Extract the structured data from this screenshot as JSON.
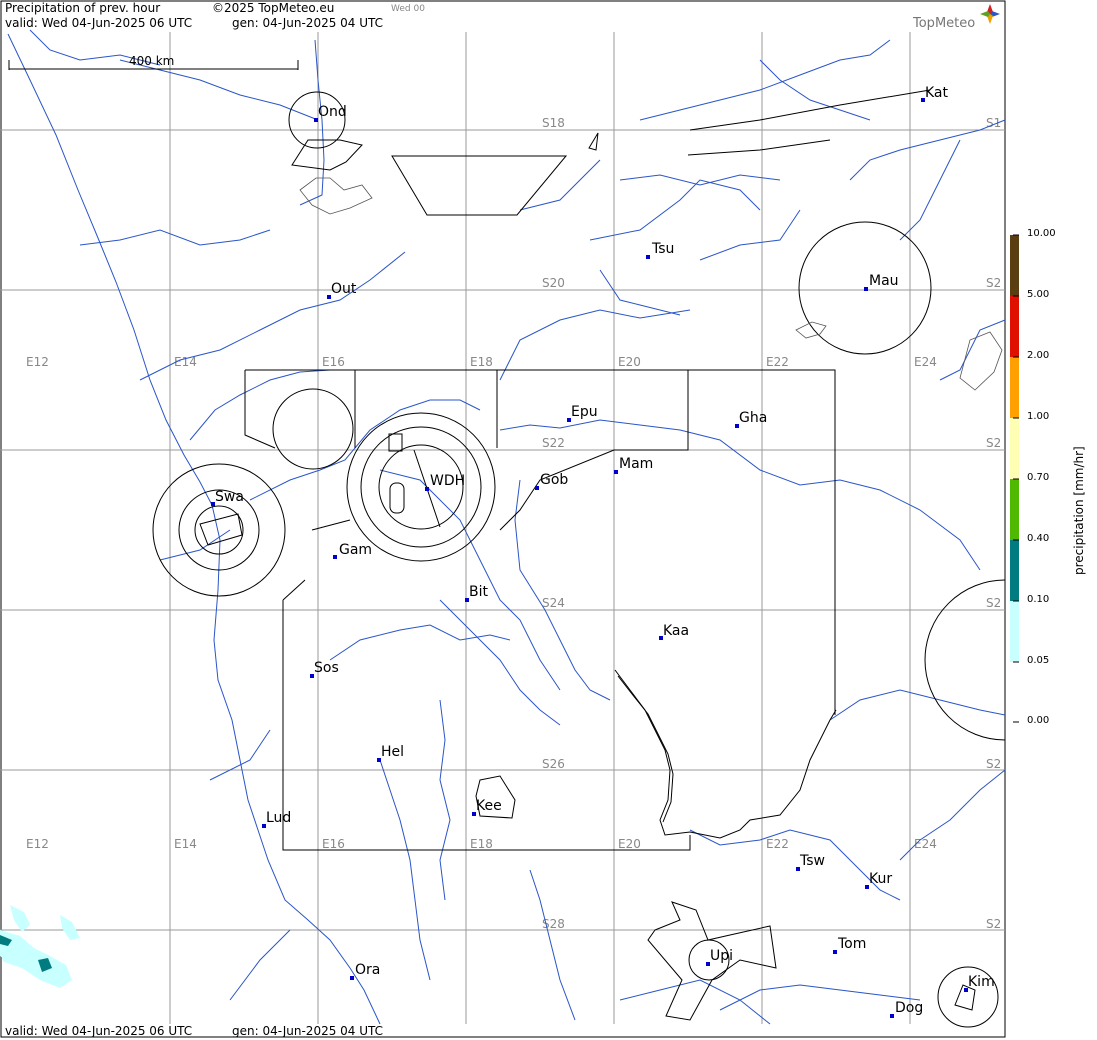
{
  "header": {
    "product": "Precipitation of prev. hour",
    "copyright": "©2025 TopMeteo.eu",
    "valid": "valid:  Wed  04-Jun-2025  06 UTC",
    "gen": "gen: 04-Jun-2025 04 UTC",
    "run": "Wed 00",
    "brand": "TopMeteo"
  },
  "footer": {
    "valid": "valid:  Wed  04-Jun-2025  06 UTC",
    "gen": "gen: 04-Jun-2025 04 UTC"
  },
  "scale_bar": {
    "label": "400 km"
  },
  "grid_labels": {
    "lon": [
      "E12",
      "E14",
      "E16",
      "E18",
      "E20",
      "E22",
      "E24"
    ],
    "lat": [
      "S18",
      "S20",
      "S22",
      "S24",
      "S26",
      "S28"
    ],
    "lat_right": [
      "S1",
      "S2",
      "S2",
      "S2",
      "S2",
      "S2"
    ]
  },
  "cities": [
    {
      "code": "Ond"
    },
    {
      "code": "Kat"
    },
    {
      "code": "Tsu"
    },
    {
      "code": "Out"
    },
    {
      "code": "Mau"
    },
    {
      "code": "Epu"
    },
    {
      "code": "Gha"
    },
    {
      "code": "Mam"
    },
    {
      "code": "Gob"
    },
    {
      "code": "WDH"
    },
    {
      "code": "Swa"
    },
    {
      "code": "Gam"
    },
    {
      "code": "Bit"
    },
    {
      "code": "Kaa"
    },
    {
      "code": "Sos"
    },
    {
      "code": "Hel"
    },
    {
      "code": "Lud"
    },
    {
      "code": "Kee"
    },
    {
      "code": "Tsw"
    },
    {
      "code": "Kur"
    },
    {
      "code": "Tom"
    },
    {
      "code": "Upi"
    },
    {
      "code": "Ora"
    },
    {
      "code": "Kim"
    },
    {
      "code": "Dog"
    }
  ],
  "legend": {
    "title": "precipitation [mm/hr]",
    "levels": [
      "10.00",
      "5.00",
      "2.00",
      "1.00",
      "0.70",
      "0.40",
      "0.10",
      "0.05",
      "0.00"
    ],
    "colors": [
      "#5a3d10",
      "#e01000",
      "#ff9f00",
      "#ffffb4",
      "#4fb800",
      "#007b80",
      "#c8ffff"
    ]
  },
  "colors": {
    "grid": "#9a9a9a",
    "rivers": "#2a55c8",
    "borders": "#000000",
    "city_marker": "#0000cc",
    "precip_light": "#c8ffff",
    "precip_mid": "#007b80"
  }
}
